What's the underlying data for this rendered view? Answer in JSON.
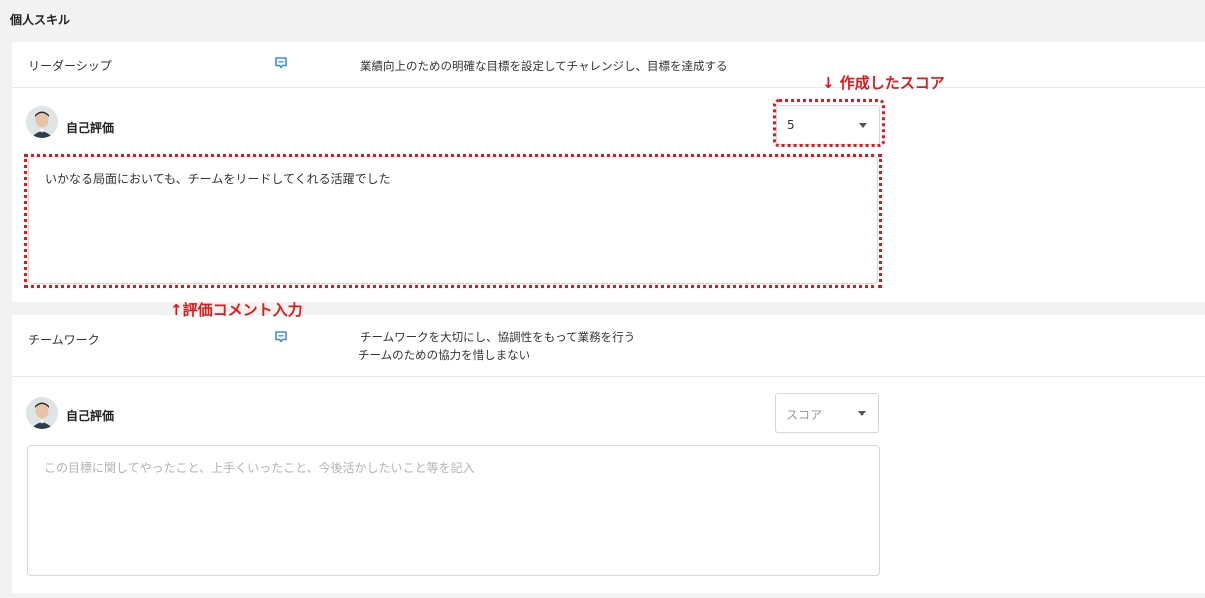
{
  "section_title": "個人スキル",
  "skills": [
    {
      "name": "リーダーシップ",
      "description": [
        "業績向上のための明確な目標を設定してチャレンジし、目標を達成する"
      ],
      "self_eval_label": "自己評価",
      "score": "5",
      "comment": "いかなる局面においても、チームをリードしてくれる活躍でした"
    },
    {
      "name": "チームワーク",
      "description": [
        "チームワークを大切にし、協調性をもって業務を行う",
        "チームのための協力を惜しまない"
      ],
      "self_eval_label": "自己評価",
      "score_placeholder": "スコア",
      "comment_placeholder": "この目標に関してやったこと、上手くいったこと、今後活かしたいこと等を記入"
    }
  ],
  "annotations": {
    "score_note": "↓ 作成したスコア",
    "comment_note": "↑評価コメント入力"
  },
  "colors": {
    "annotation_red": "#e01818",
    "icon_blue": "#3b8ee8"
  },
  "icons": {
    "comment": "comment-icon",
    "avatar": "avatar"
  }
}
